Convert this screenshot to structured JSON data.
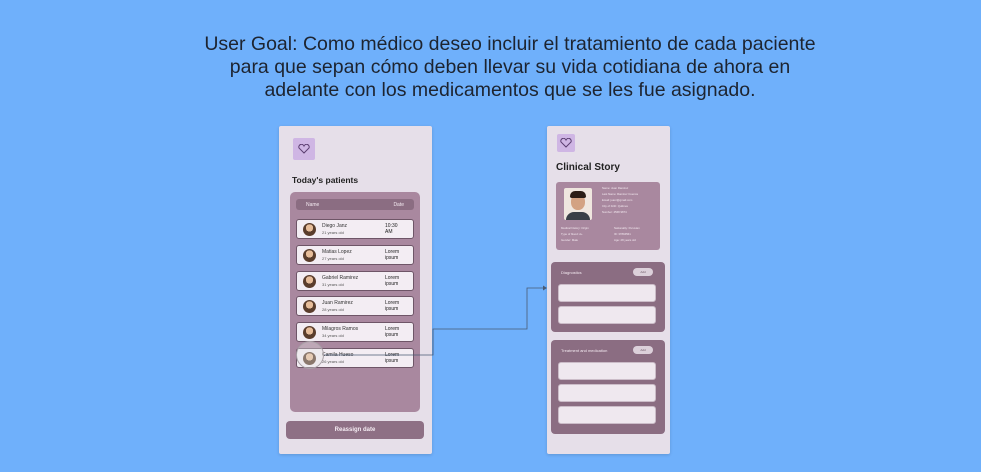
{
  "user_goal": "User Goal: Como médico deseo incluir el tratamiento de cada paciente para que sepan cómo deben llevar su vida cotidiana de ahora en adelante con los medicamentos que se les fue asignado.",
  "screen1": {
    "title": "Today's patients",
    "table_header": {
      "name": "Name",
      "date": "Date"
    },
    "patients": [
      {
        "name": "Diego Janz",
        "age": "21 years old",
        "date": "10:30 AM"
      },
      {
        "name": "Matias Lopez",
        "age": "27 years old",
        "date": "Lorem ipsum"
      },
      {
        "name": "Gabriel Ramirez",
        "age": "31 years old",
        "date": "Lorem ipsum"
      },
      {
        "name": "Juan Ramirez",
        "age": "28 years old",
        "date": "Lorem ipsum"
      },
      {
        "name": "Milagros Ramos",
        "age": "34 years old",
        "date": "Lorem ipsum"
      },
      {
        "name": "Camila Hueso",
        "age": "26 years old",
        "date": "Lorem ipsum"
      }
    ],
    "reassign_button": "Reassign date"
  },
  "screen2": {
    "title": "Clinical Story",
    "profile": {
      "lines_right": [
        "Name: Juan Ramirez",
        "Last Name: Ramirez Cuenca",
        "Email: juanr@gmail.com",
        "City of birth: Quilmes",
        "Number: 4568 9874"
      ],
      "lines_bottom_left": [
        "Medical history: Origin",
        "Type of blood: A+",
        "Gender: Male"
      ],
      "lines_bottom_right": [
        "Nationality: Peruvian",
        "ID: 37894561",
        "Age: 28 years old"
      ]
    },
    "diagnostics_label": "Diagnostics",
    "treatment_label": "Treatment and medication",
    "add_label": "Add"
  },
  "colors": {
    "background": "#6fb0fb",
    "phone": "#e6dfe9",
    "panel": "#a9889f",
    "panel_dark": "#8b6d82"
  },
  "icons": [
    "logo-icon",
    "avatar",
    "arrow-connector"
  ]
}
